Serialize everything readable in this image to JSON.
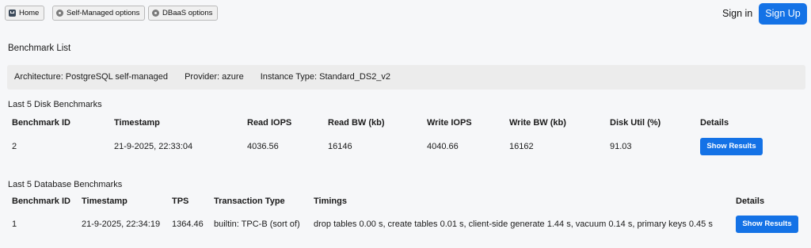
{
  "nav": {
    "home_label": "Home",
    "self_managed_label": "Self-Managed options",
    "dbaas_label": "DBaaS options",
    "sign_in_label": "Sign in",
    "sign_up_label": "Sign Up"
  },
  "benchmark_list_title": "Benchmark List",
  "info": {
    "architecture": "Architecture: PostgreSQL self-managed",
    "provider": "Provider: azure",
    "instance_type": "Instance Type: Standard_DS2_v2"
  },
  "disk": {
    "title": "Last 5 Disk Benchmarks",
    "headers": [
      "Benchmark ID",
      "Timestamp",
      "Read IOPS",
      "Read BW (kb)",
      "Write IOPS",
      "Write BW (kb)",
      "Disk Util (%)",
      "Details"
    ],
    "rows": [
      {
        "id": "2",
        "timestamp": "21-9-2025, 22:33:04",
        "read_iops": "4036.56",
        "read_bw": "16146",
        "write_iops": "4040.66",
        "write_bw": "16162",
        "disk_util": "91.03",
        "button": "Show Results"
      }
    ]
  },
  "database": {
    "title": "Last 5 Database Benchmarks",
    "headers": [
      "Benchmark ID",
      "Timestamp",
      "TPS",
      "Transaction Type",
      "Timings",
      "Details"
    ],
    "rows": [
      {
        "id": "1",
        "timestamp": "21-9-2025, 22:34:19",
        "tps": "1364.46",
        "transaction_type": "builtin: TPC-B (sort of)",
        "timings": "drop tables 0.00 s, create tables 0.01 s, client-side generate 1.44 s, vacuum 0.14 s, primary keys 0.45 s",
        "button": "Show Results"
      }
    ]
  }
}
